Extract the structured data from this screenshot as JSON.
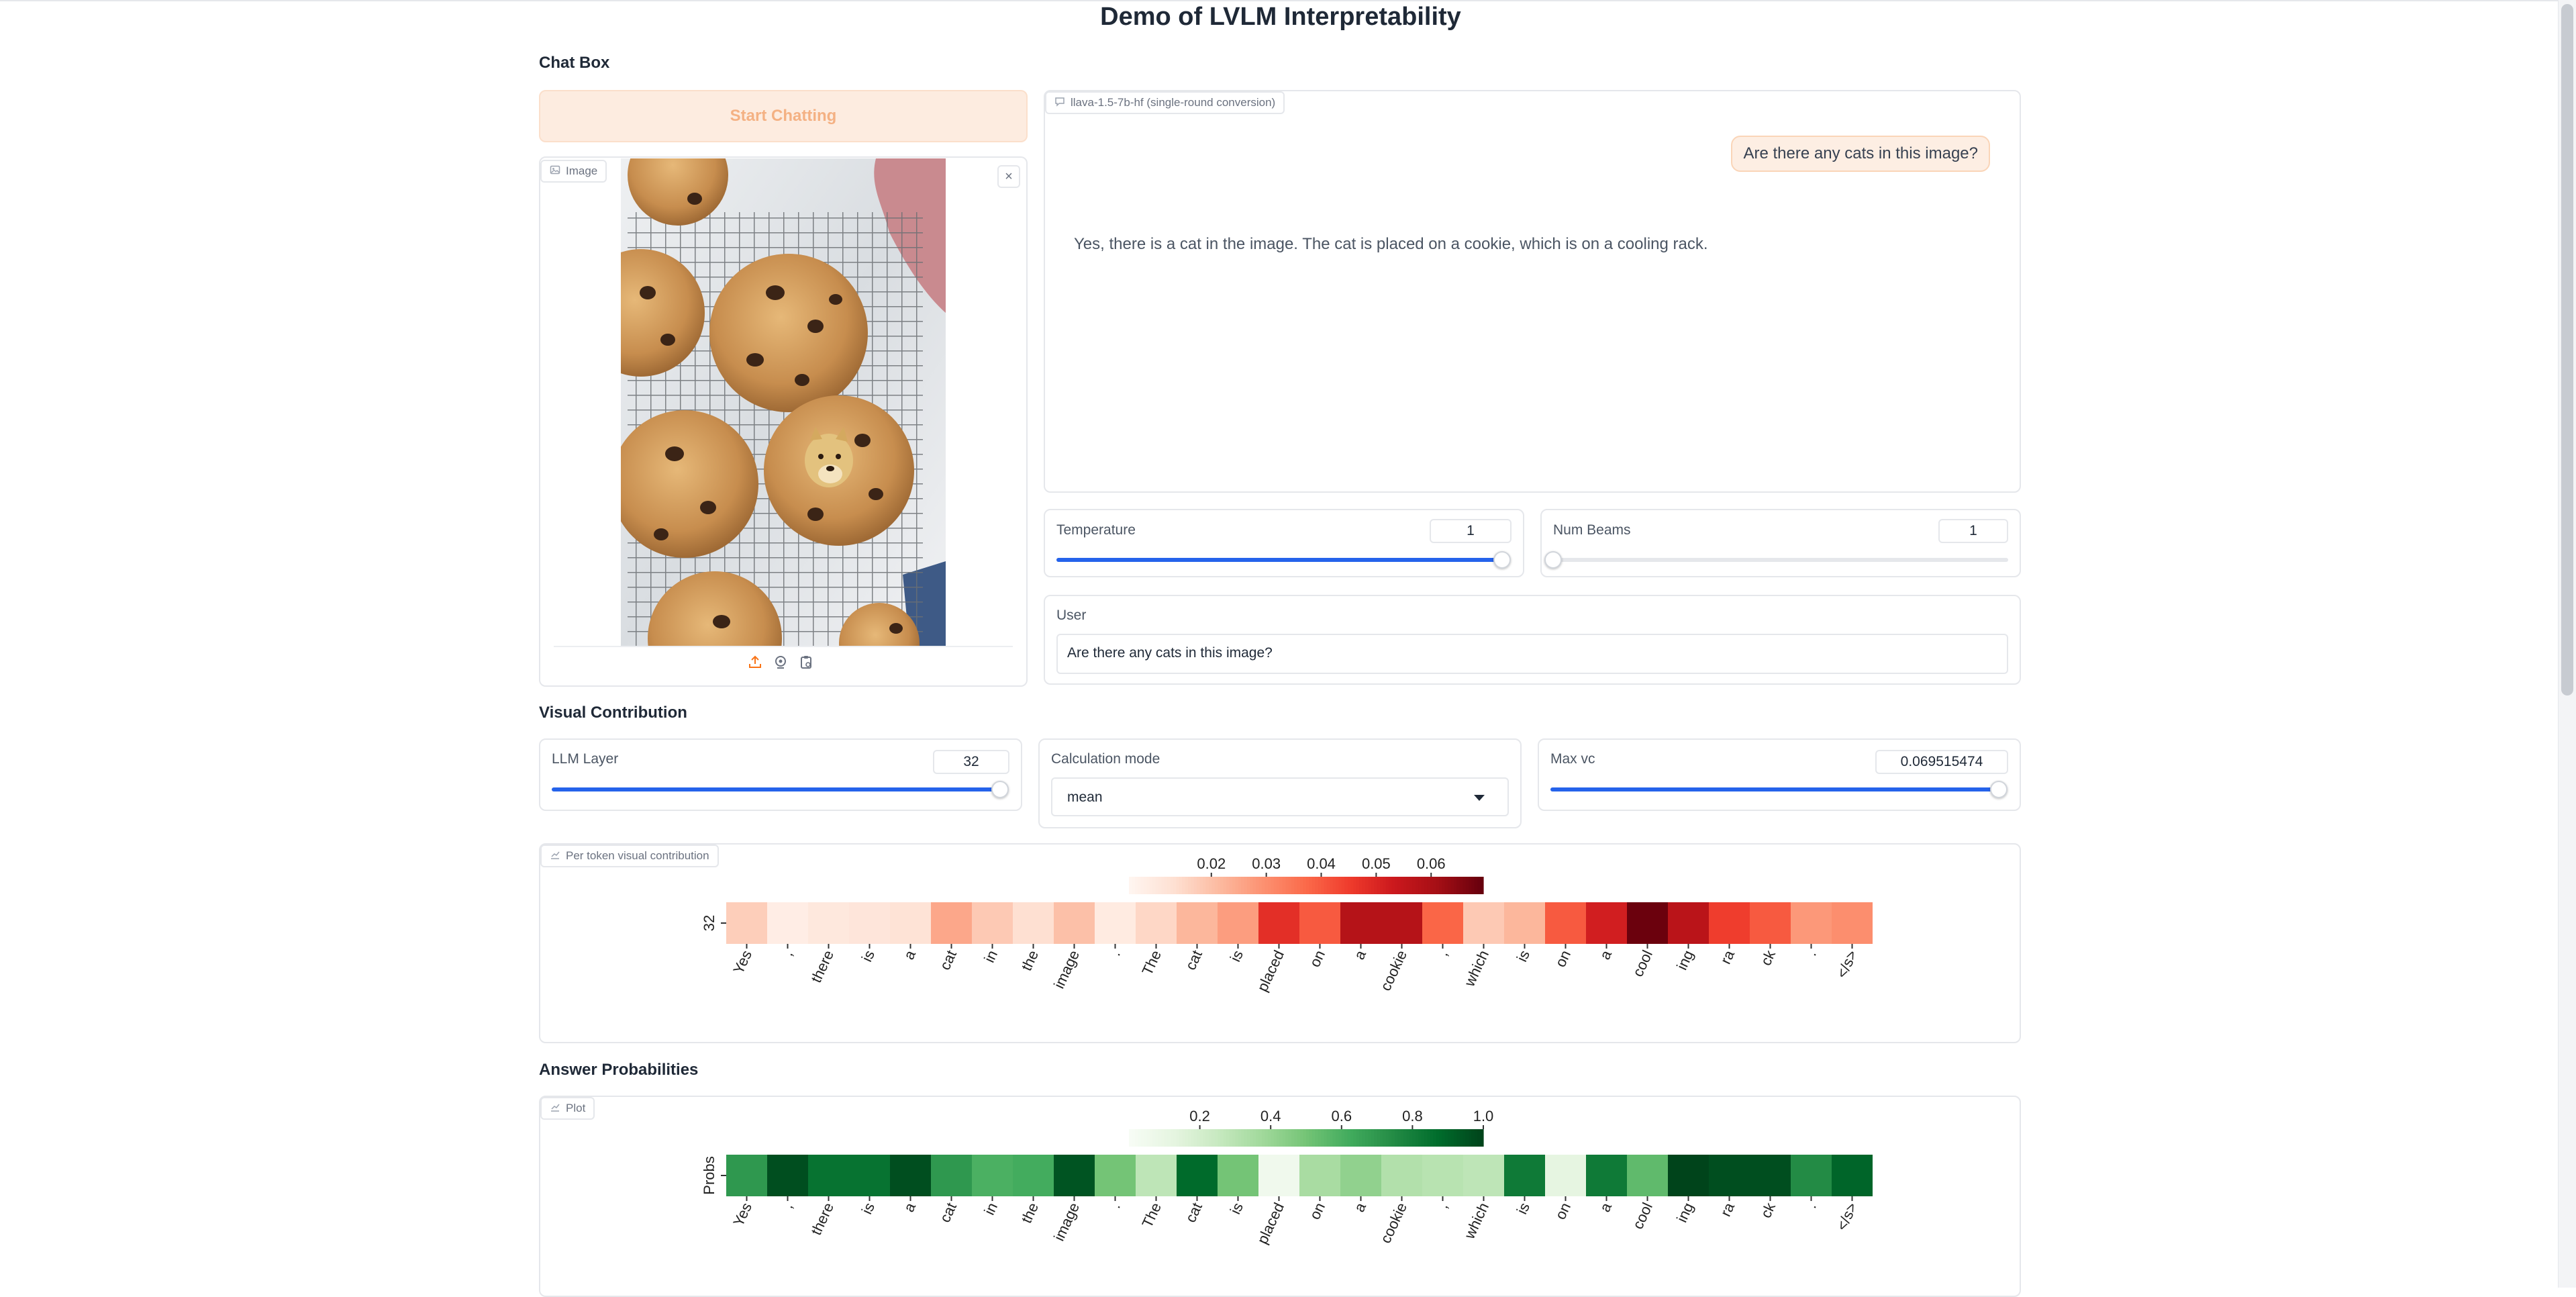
{
  "title": "Demo of LVLM Interpretability",
  "chatbox": {
    "heading": "Chat Box",
    "start_button": "Start Chatting",
    "image_label": "Image",
    "close_glyph": "×",
    "model_label": "llava-1.5-7b-hf (single-round conversion)",
    "user_message": "Are there any cats in this image?",
    "bot_message": "Yes, there is a cat in the image. The cat is placed on a cookie, which is on a cooling rack."
  },
  "controls": {
    "temperature_label": "Temperature",
    "temperature_value": "1",
    "temperature_fraction": 1.0,
    "num_beams_label": "Num Beams",
    "num_beams_value": "1",
    "num_beams_fraction": 0.0,
    "user_label": "User",
    "user_input": "Are there any cats in this image?"
  },
  "visual_contribution": {
    "heading": "Visual Contribution",
    "llm_layer_label": "LLM Layer",
    "llm_layer_value": "32",
    "llm_layer_fraction": 1.0,
    "calc_mode_label": "Calculation mode",
    "calc_mode_value": "mean",
    "max_vc_label": "Max vc",
    "max_vc_value": "0.069515474",
    "max_vc_fraction": 1.0,
    "plot_label": "Per token visual contribution"
  },
  "answer_probabilities": {
    "heading": "Answer Probabilities",
    "plot_label": "Plot"
  },
  "colors": {
    "accent": "#f97316",
    "slider": "#2563eb",
    "reds": "Reds",
    "greens": "Greens"
  },
  "chart_data": [
    {
      "type": "heatmap",
      "colormap": "Reds",
      "y_categories": [
        "32"
      ],
      "x_categories": [
        "Yes",
        ",",
        "there",
        "is",
        "a",
        "cat",
        "in",
        "the",
        "image",
        ".",
        "The",
        "cat",
        "is",
        "placed",
        "on",
        "a",
        "cookie",
        ",",
        "which",
        "is",
        "on",
        "a",
        "cool",
        "ing",
        "ra",
        "ck",
        ".",
        "</s>"
      ],
      "values": [
        0.017,
        0.008,
        0.01,
        0.011,
        0.012,
        0.025,
        0.018,
        0.013,
        0.02,
        0.009,
        0.015,
        0.022,
        0.027,
        0.048,
        0.04,
        0.058,
        0.058,
        0.038,
        0.018,
        0.022,
        0.04,
        0.052,
        0.069,
        0.057,
        0.045,
        0.04,
        0.028,
        0.03
      ],
      "colorbar_ticks": [
        0.02,
        0.03,
        0.04,
        0.05,
        0.06
      ],
      "colorbar_range": [
        0.005,
        0.0695
      ]
    },
    {
      "type": "heatmap",
      "colormap": "Greens",
      "y_categories": [
        "Probs"
      ],
      "x_categories": [
        "Yes",
        ",",
        "there",
        "is",
        "a",
        "cat",
        "in",
        "the",
        "image",
        ".",
        "The",
        "cat",
        "is",
        "placed",
        "on",
        "a",
        "cookie",
        ",",
        "which",
        "is",
        "on",
        "a",
        "cool",
        "ing",
        "ra",
        "ck",
        ".",
        "</s>"
      ],
      "values": [
        0.7,
        0.97,
        0.85,
        0.85,
        0.97,
        0.7,
        0.6,
        0.62,
        0.95,
        0.5,
        0.28,
        0.88,
        0.5,
        0.05,
        0.35,
        0.42,
        0.32,
        0.3,
        0.28,
        0.82,
        0.12,
        0.82,
        0.55,
        1.0,
        0.97,
        0.97,
        0.75,
        0.9
      ],
      "colorbar_ticks": [
        0.2,
        0.4,
        0.6,
        0.8,
        1.0
      ],
      "colorbar_range": [
        0.0,
        1.0
      ]
    }
  ]
}
